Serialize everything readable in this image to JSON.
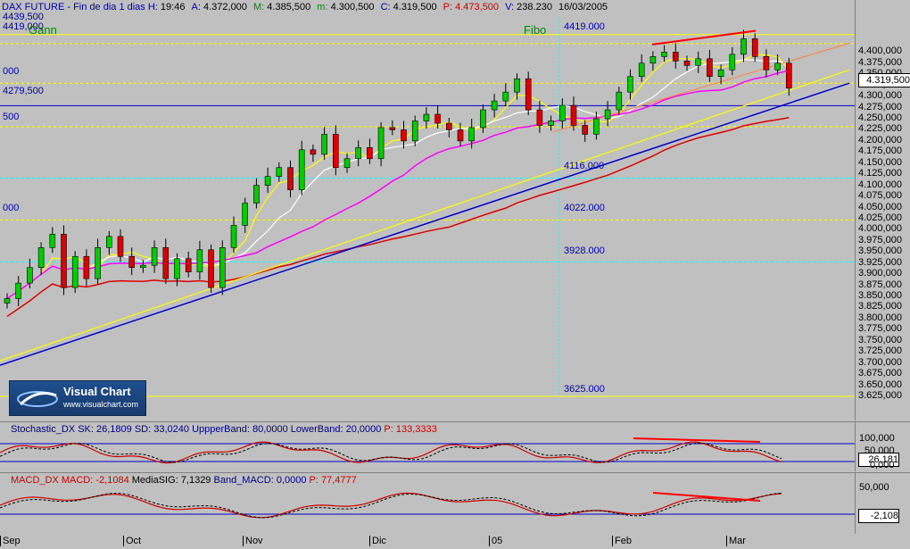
{
  "header": {
    "symbol": "DAX FUTURE",
    "period": "Fin de dia 1 dias",
    "h_label": "H:",
    "h_val": "19:46",
    "a_label": "A:",
    "a_val": "4.372,000",
    "m_label": "M:",
    "m_val": "4.385,500",
    "mn_label": "m:",
    "mn_val": "4.300,500",
    "c_label": "C:",
    "c_val": "4.319,500",
    "p_label": "P:",
    "p_val": "4.473,500",
    "v_label": "V:",
    "v_val": "238.230",
    "date": "16/03/2005"
  },
  "labels": {
    "gann": "Gann",
    "fibo": "Fibo",
    "l4439": "4439,500",
    "l4419": "4419,000",
    "l4279": "4279,500",
    "lfib4419": "4419.000",
    "lfib4116": "4116.000",
    "lfib4022": "4022.000",
    "lfib3928": "3928.000",
    "lfib3625": "3625.000",
    "left000a": "000",
    "left500": "500",
    "left000b": "000"
  },
  "logo": {
    "name": "Visual Chart",
    "url": "www.visualchart.com"
  },
  "price_axis": {
    "ticks": [
      "4.400,000",
      "4.375,000",
      "4.350,000",
      "4.325,000",
      "4.300,000",
      "4.275,000",
      "4.250,000",
      "4.225,000",
      "4.200,000",
      "4.175,000",
      "4.150,000",
      "4.125,000",
      "4.100,000",
      "4.075,000",
      "4.050,000",
      "4.025,000",
      "4.000,000",
      "3.975,000",
      "3.950,000",
      "3.925,000",
      "3.900,000",
      "3.875,000",
      "3.850,000",
      "3.825,000",
      "3.800,000",
      "3.775,000",
      "3.750,000",
      "3.725,000",
      "3.700,000",
      "3.675,000",
      "3.650,000",
      "3.625,000"
    ],
    "current": "4.319,500"
  },
  "stoch": {
    "title": "Stochastic_DX",
    "sk_label": "SK:",
    "sk": "26,1809",
    "sd_label": "SD:",
    "sd": "33,0240",
    "ub_label": "UppperBand:",
    "ub": "80,0000",
    "lb_label": "LowerBand:",
    "lb": "20,0000",
    "p_label": "P:",
    "p": "133,3333",
    "axis_top": "100,000",
    "axis_mid": "50,000",
    "axis_bot": "0,000",
    "current": "26,181"
  },
  "macd": {
    "title": "MACD_DX",
    "macd_label": "MACD:",
    "macd": "-2,1084",
    "sig_label": "MediaSIG:",
    "sig": "7,1329",
    "band_label": "Band_MACD:",
    "band": "0,0000",
    "p_label": "P:",
    "p": "77,4777",
    "axis_top": "50,000",
    "current": "-2,108"
  },
  "xaxis": {
    "labels": [
      "Sep",
      "Oct",
      "Nov",
      "Dic",
      "05",
      "Feb",
      "Mar"
    ]
  },
  "colors": {
    "bg": "#c0c0c0",
    "up": "#00cc00",
    "down": "#dd0000",
    "gann": "#0000cc",
    "fibo": "#ffff00",
    "ma_red": "#dd0000",
    "ma_pink": "#ff00ff",
    "ma_white": "#ffffff",
    "ma_yellow": "#ffff00"
  },
  "chart_data": {
    "type": "candlestick",
    "title": "DAX FUTURE",
    "ylim": [
      3625,
      4440
    ],
    "x": [
      "Sep",
      "Oct",
      "Nov",
      "Dic",
      "05",
      "Feb",
      "Mar"
    ],
    "series": [
      {
        "name": "DAX FUTURE",
        "values": [
          3845,
          3880,
          3915,
          3960,
          3990,
          3870,
          3940,
          3890,
          3960,
          3985,
          3940,
          3915,
          3920,
          3960,
          3890,
          3935,
          3905,
          3955,
          3870,
          3960,
          4010,
          4060,
          4100,
          4120,
          4140,
          4090,
          4180,
          4170,
          4215,
          4140,
          4160,
          4185,
          4160,
          4230,
          4225,
          4200,
          4245,
          4260,
          4240,
          4225,
          4200,
          4230,
          4270,
          4290,
          4310,
          4340,
          4270,
          4235,
          4245,
          4280,
          4235,
          4215,
          4250,
          4270,
          4310,
          4345,
          4375,
          4390,
          4400,
          4380,
          4370,
          4385,
          4345,
          4360,
          4395,
          4430,
          4390,
          4360,
          4375,
          4319
        ]
      }
    ]
  }
}
